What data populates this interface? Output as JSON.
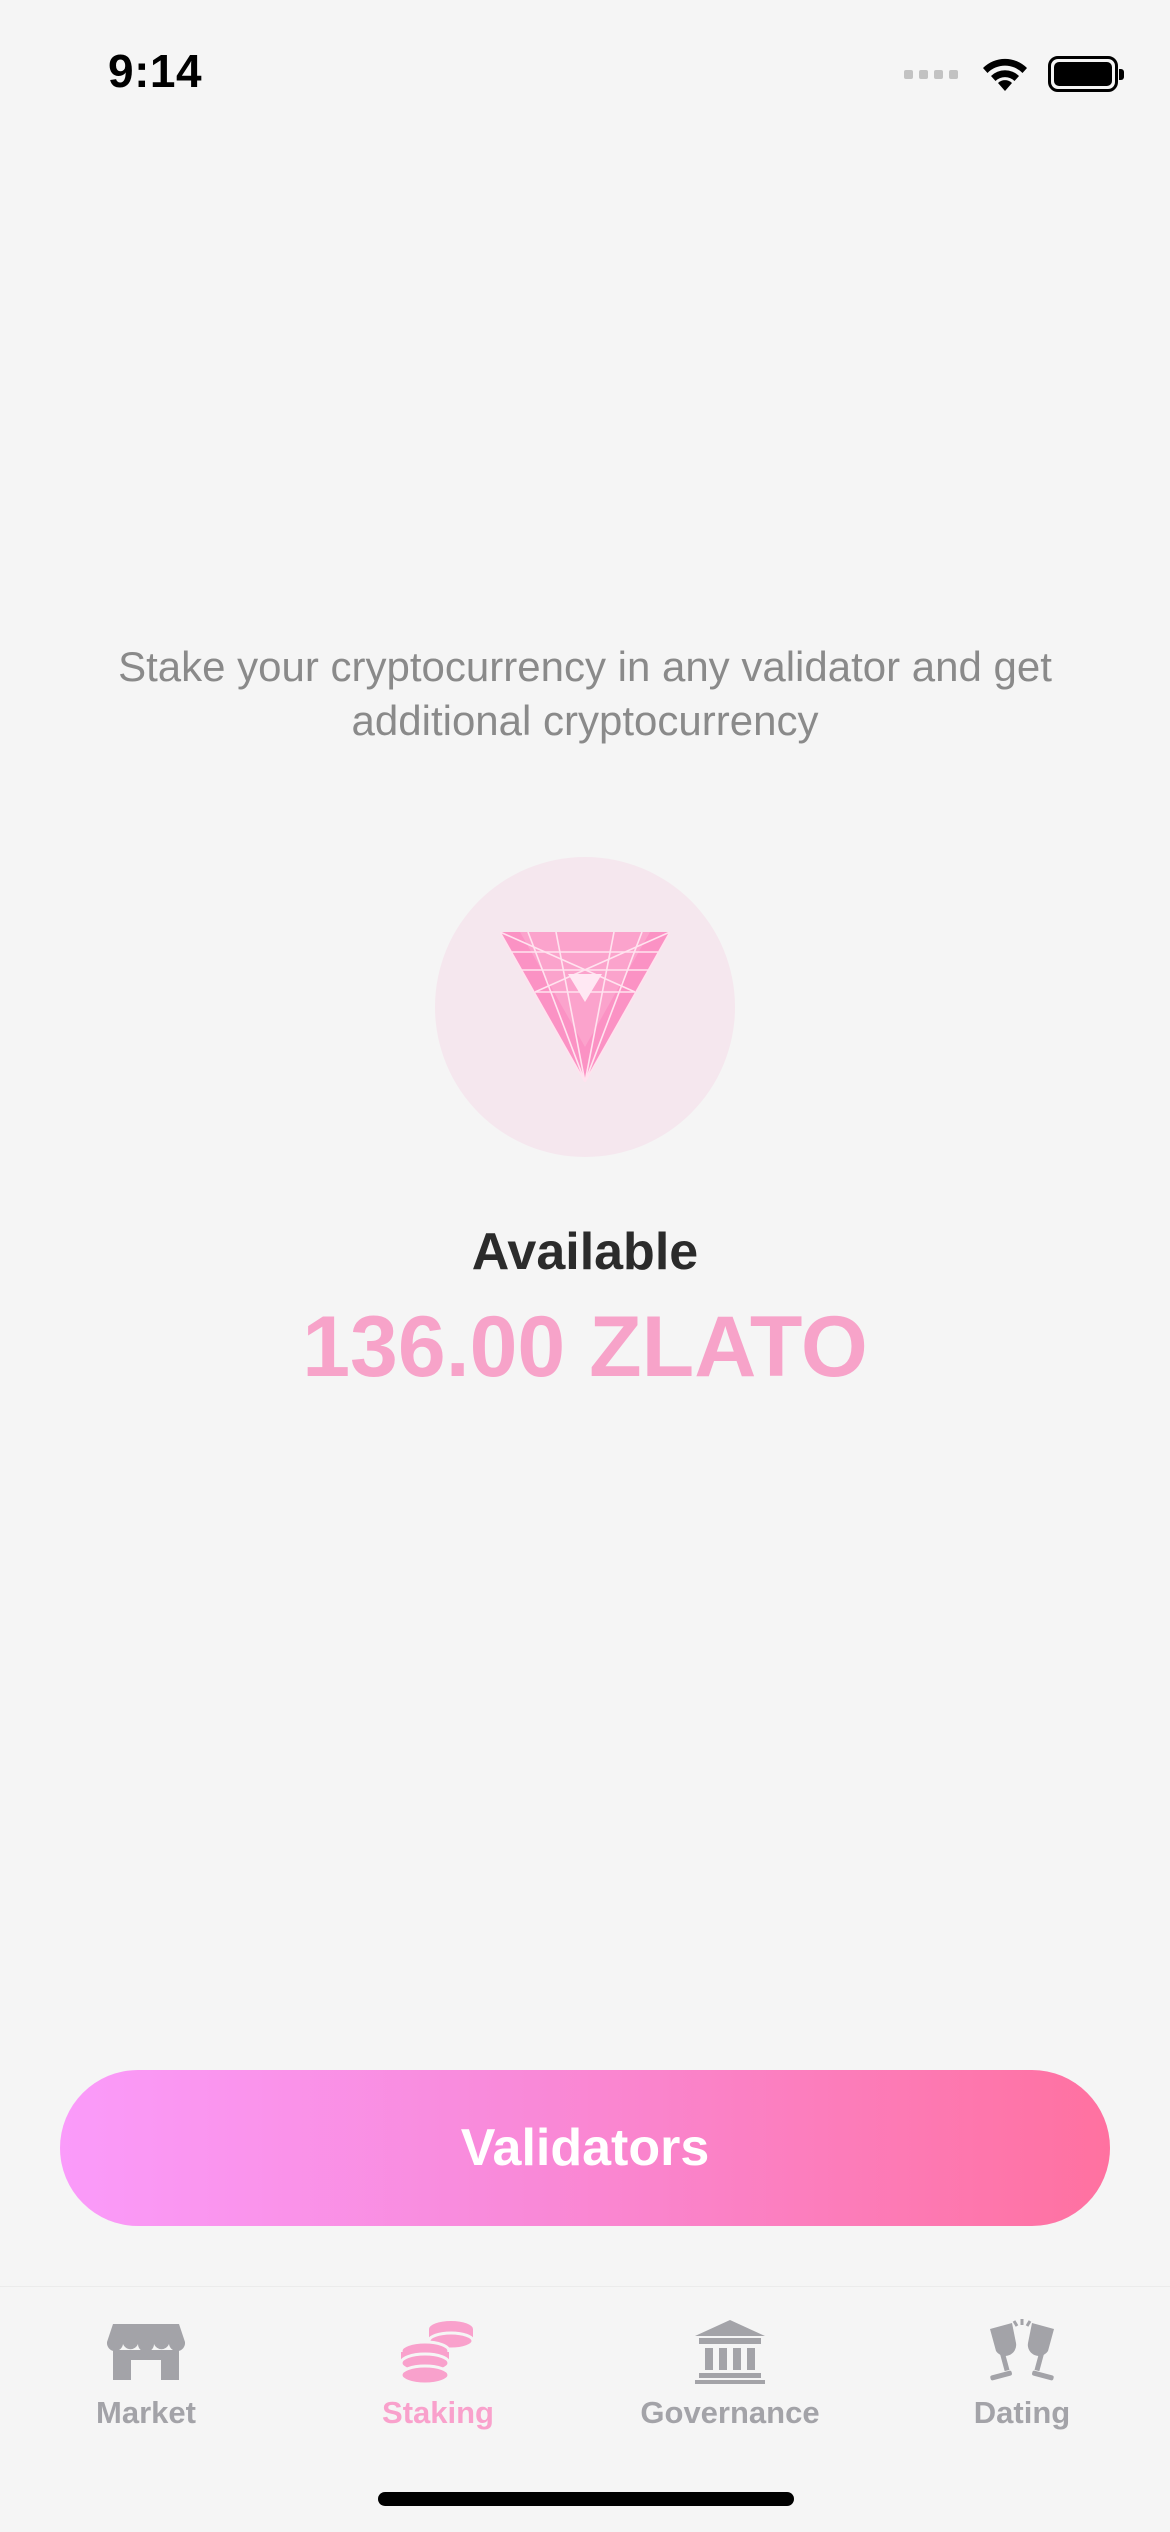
{
  "status_bar": {
    "time": "9:14",
    "icons": [
      "signal-icon",
      "wifi-icon",
      "battery-icon"
    ]
  },
  "staking": {
    "intro_text": "Stake your cryptocurrency in any validator and get additional cryptocurrency",
    "coin_icon": "zlato-logo-icon",
    "available_label": "Available",
    "available_amount": "136.00 ZLATO"
  },
  "validators_button": {
    "label": "Validators"
  },
  "tab_bar": {
    "tabs": [
      {
        "label": "Market",
        "icon": "storefront-icon",
        "active": false
      },
      {
        "label": "Staking",
        "icon": "coins-icon",
        "active": true
      },
      {
        "label": "Governance",
        "icon": "bank-icon",
        "active": false
      },
      {
        "label": "Dating",
        "icon": "glasses-toast-icon",
        "active": false
      }
    ]
  },
  "colors": {
    "background": "#f5f5f5",
    "accent_pink": "#f7a3c9",
    "button_gradient_start": "#fa9bfa",
    "button_gradient_end": "#ff71a0",
    "inactive_tab": "#a3a3a8"
  }
}
